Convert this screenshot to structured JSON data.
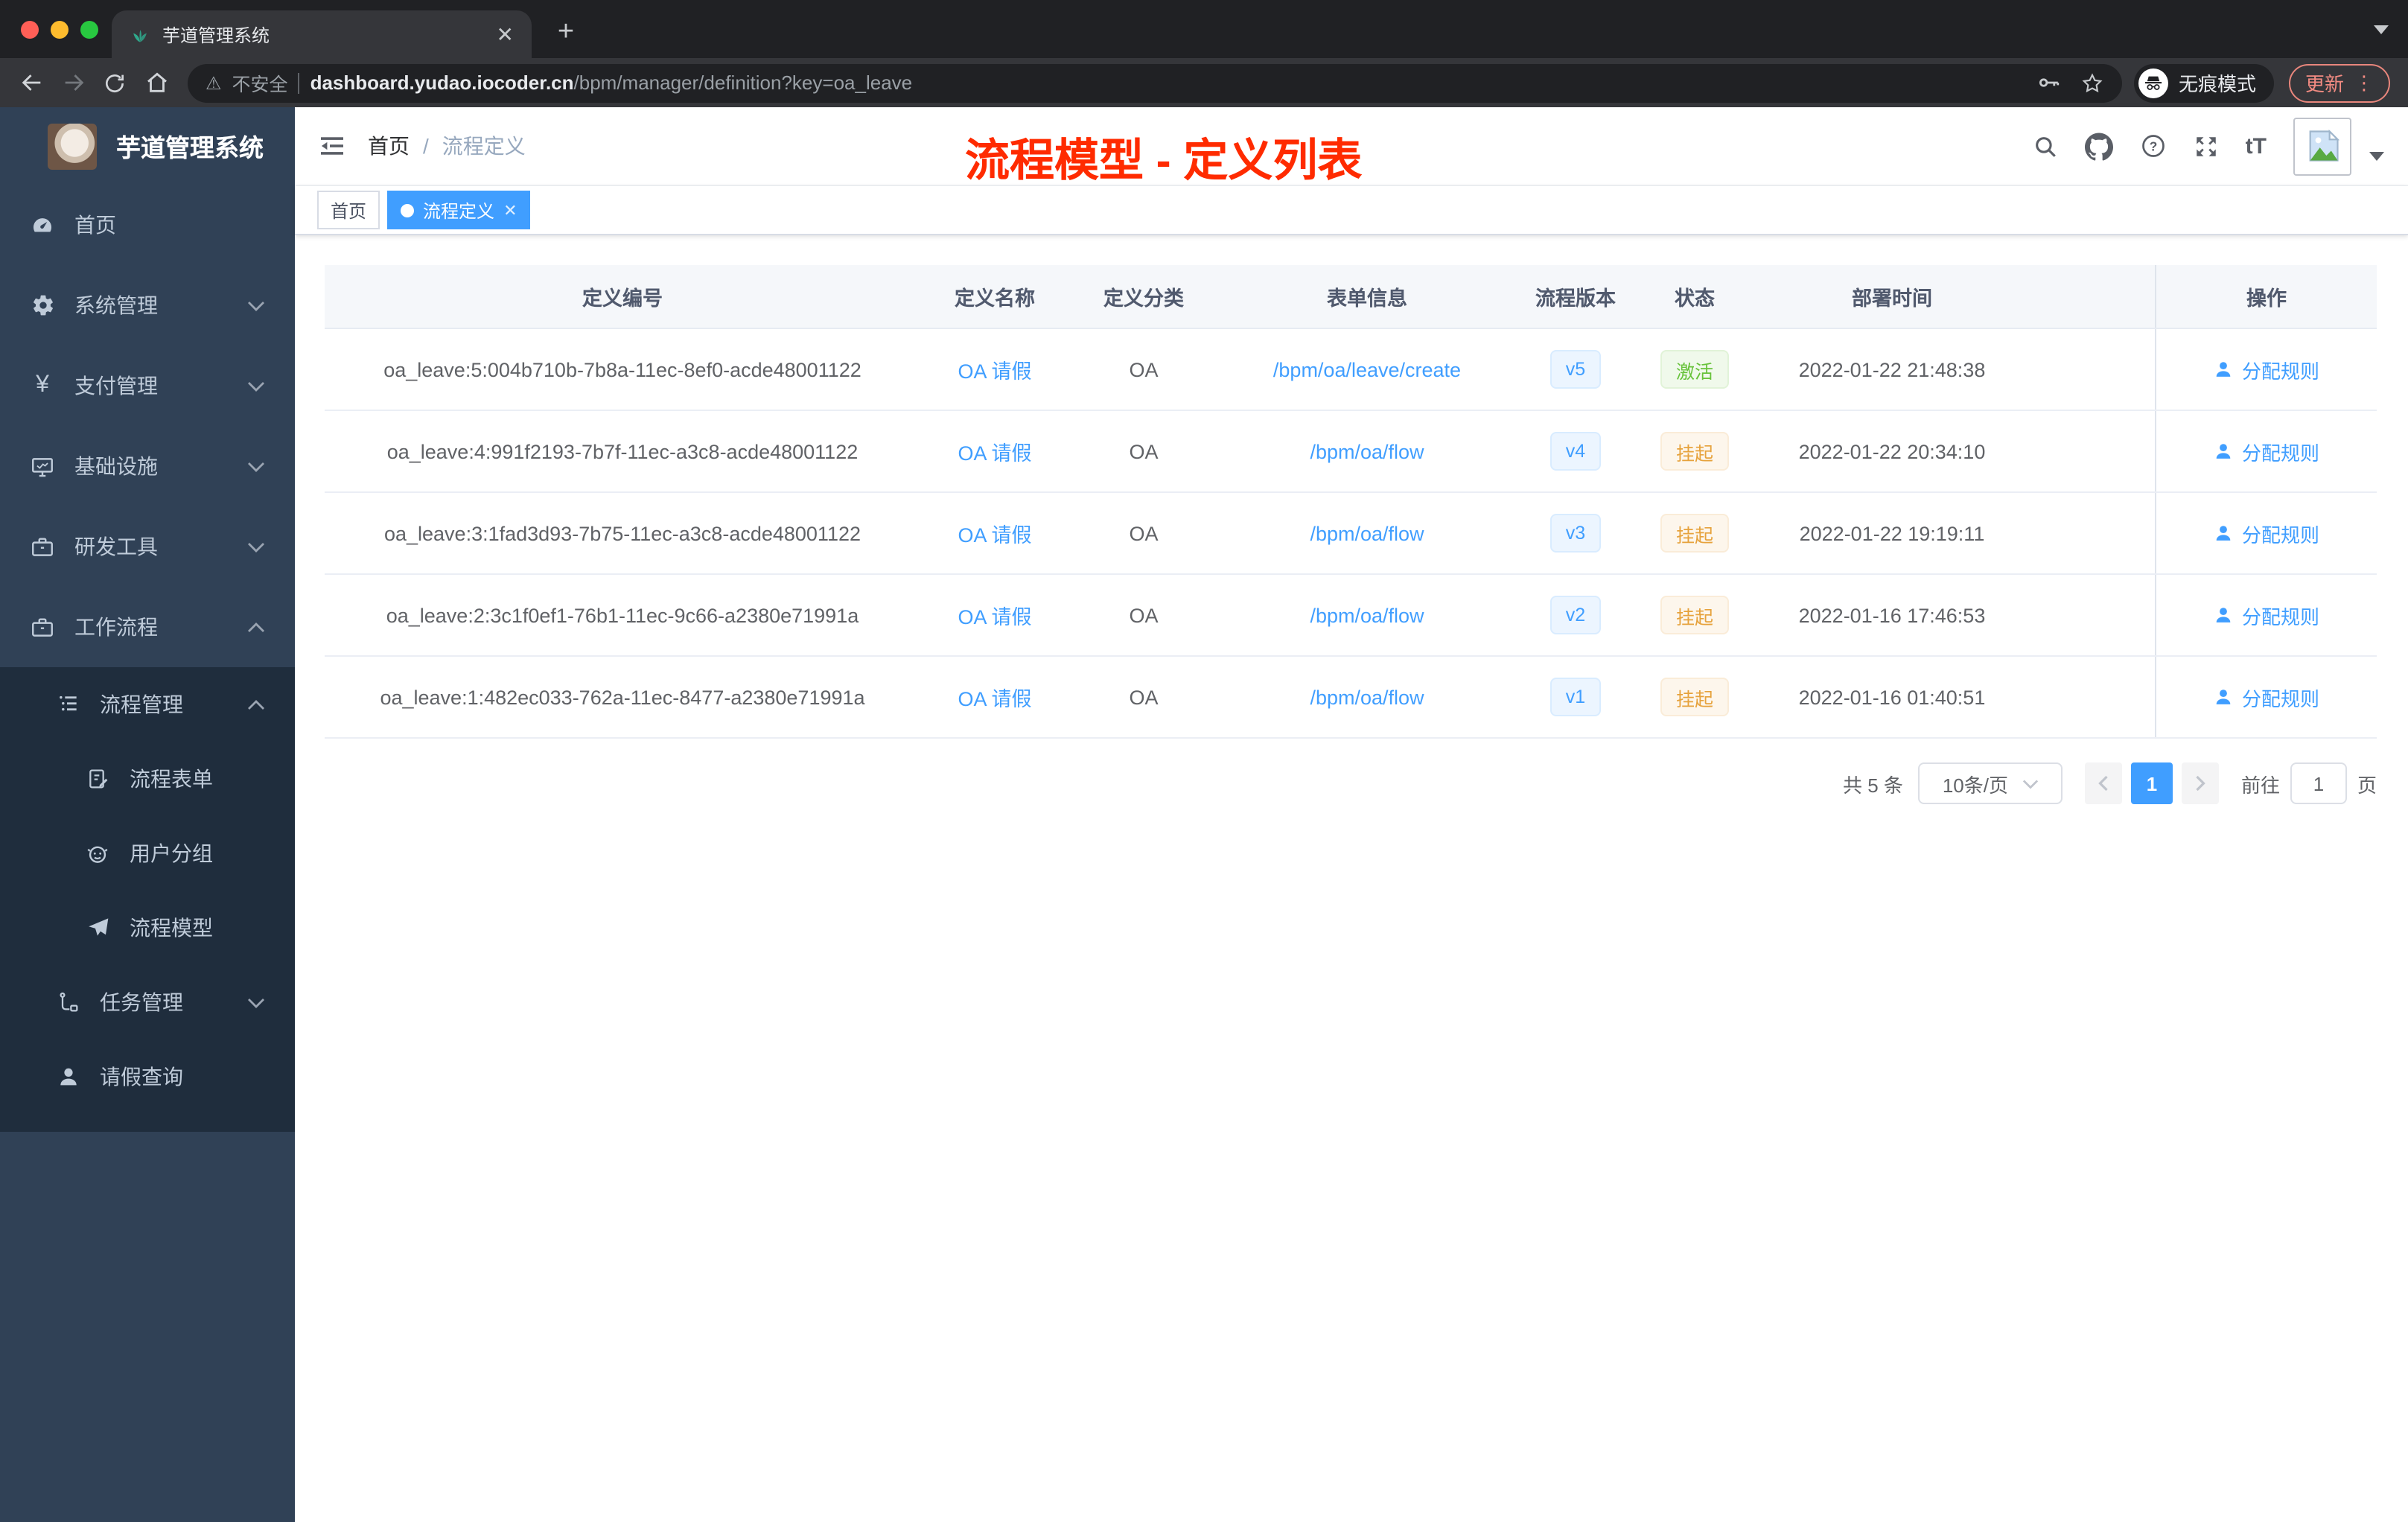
{
  "browser": {
    "tab": {
      "title": "芋道管理系统"
    },
    "toolbar": {
      "security_label": "不安全",
      "url_domain": "dashboard.yudao.iocoder.cn",
      "url_path": "/bpm/manager/definition?key=oa_leave",
      "incognito_label": "无痕模式",
      "update_label": "更新",
      "menu_dots": "⋮"
    }
  },
  "sidebar": {
    "title": "芋道管理系统",
    "menu": [
      {
        "label": "首页",
        "icon": "dashboard-icon"
      },
      {
        "label": "系统管理",
        "icon": "gear-icon"
      },
      {
        "label": "支付管理",
        "icon": "yen-icon"
      },
      {
        "label": "基础设施",
        "icon": "monitor-icon"
      },
      {
        "label": "研发工具",
        "icon": "toolbox-icon"
      },
      {
        "label": "工作流程",
        "icon": "toolbox-icon"
      },
      {
        "label": "流程管理",
        "icon": "list-icon"
      },
      {
        "label": "流程表单",
        "icon": "form-icon"
      },
      {
        "label": "用户分组",
        "icon": "user-group-icon"
      },
      {
        "label": "流程模型",
        "icon": "send-icon"
      },
      {
        "label": "任务管理",
        "icon": "tree-icon"
      },
      {
        "label": "请假查询",
        "icon": "user-icon"
      }
    ]
  },
  "header": {
    "breadcrumb_home": "首页",
    "breadcrumb_sep": "/",
    "breadcrumb_current": "流程定义",
    "font_size_icon": "tT"
  },
  "tags": {
    "home": "首页",
    "active": "流程定义"
  },
  "annotation": "流程模型 - 定义列表",
  "table": {
    "columns": [
      "定义编号",
      "定义名称",
      "定义分类",
      "表单信息",
      "流程版本",
      "状态",
      "部署时间",
      "操作"
    ],
    "action_label": "分配规则",
    "rows": [
      {
        "id": "oa_leave:5:004b710b-7b8a-11ec-8ef0-acde48001122",
        "name": "OA 请假",
        "category": "OA",
        "form": "/bpm/oa/leave/create",
        "version": "v5",
        "status": "激活",
        "status_type": "success",
        "time": "2022-01-22 21:48:38"
      },
      {
        "id": "oa_leave:4:991f2193-7b7f-11ec-a3c8-acde48001122",
        "name": "OA 请假",
        "category": "OA",
        "form": "/bpm/oa/flow",
        "version": "v4",
        "status": "挂起",
        "status_type": "warning",
        "time": "2022-01-22 20:34:10"
      },
      {
        "id": "oa_leave:3:1fad3d93-7b75-11ec-a3c8-acde48001122",
        "name": "OA 请假",
        "category": "OA",
        "form": "/bpm/oa/flow",
        "version": "v3",
        "status": "挂起",
        "status_type": "warning",
        "time": "2022-01-22 19:19:11"
      },
      {
        "id": "oa_leave:2:3c1f0ef1-76b1-11ec-9c66-a2380e71991a",
        "name": "OA 请假",
        "category": "OA",
        "form": "/bpm/oa/flow",
        "version": "v2",
        "status": "挂起",
        "status_type": "warning",
        "time": "2022-01-16 17:46:53"
      },
      {
        "id": "oa_leave:1:482ec033-762a-11ec-8477-a2380e71991a",
        "name": "OA 请假",
        "category": "OA",
        "form": "/bpm/oa/flow",
        "version": "v1",
        "status": "挂起",
        "status_type": "warning",
        "time": "2022-01-16 01:40:51"
      }
    ]
  },
  "pagination": {
    "total": "共 5 条",
    "page_size": "10条/页",
    "current_page": "1",
    "goto_label": "前往",
    "goto_value": "1",
    "page_unit": "页"
  },
  "colors": {
    "accent": "#409eff",
    "success": "#67c23a",
    "warning": "#e6a23c",
    "sidebar_bg": "#304156",
    "submenu_bg": "#1f2d3d",
    "annotation": "#ff2b00"
  }
}
